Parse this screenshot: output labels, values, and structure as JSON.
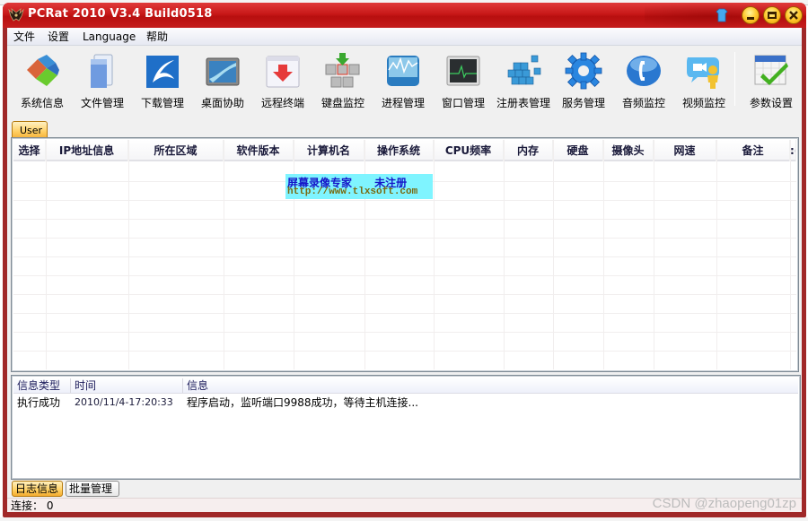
{
  "window": {
    "title": "PCRat 2010 V3.4 Build0518",
    "controls": {
      "skin": "skin-shirt-icon",
      "minimize": "minimize-icon",
      "maximize": "maximize-icon",
      "close": "close-icon"
    }
  },
  "menubar": {
    "items": [
      {
        "label": "文件"
      },
      {
        "label": "设置"
      },
      {
        "label": "Language"
      },
      {
        "label": "帮助"
      }
    ]
  },
  "toolbar": {
    "buttons": [
      {
        "label": "系统信息",
        "icon": "system-info-icon"
      },
      {
        "label": "文件管理",
        "icon": "file-manager-icon"
      },
      {
        "label": "下载管理",
        "icon": "download-manager-icon"
      },
      {
        "label": "桌面协助",
        "icon": "desktop-assist-icon"
      },
      {
        "label": "远程终端",
        "icon": "remote-terminal-icon"
      },
      {
        "label": "键盘监控",
        "icon": "keyboard-monitor-icon"
      },
      {
        "label": "进程管理",
        "icon": "process-manager-icon"
      },
      {
        "label": "窗口管理",
        "icon": "window-manager-icon"
      },
      {
        "label": "注册表管理",
        "icon": "registry-manager-icon"
      },
      {
        "label": "服务管理",
        "icon": "service-manager-icon"
      },
      {
        "label": "音频监控",
        "icon": "audio-monitor-icon"
      },
      {
        "label": "视频监控",
        "icon": "video-monitor-icon"
      },
      {
        "label": "参数设置",
        "icon": "settings-calendar-icon"
      }
    ]
  },
  "group_tab": {
    "label": "User"
  },
  "host_grid": {
    "columns": [
      "选择",
      "IP地址信息",
      "所在区域",
      "软件版本",
      "计算机名",
      "操作系统",
      "CPU频率",
      "内存",
      "硬盘",
      "摄像头",
      "网速",
      "备注",
      ":("
    ],
    "rows": []
  },
  "watermark": {
    "line1": "屏幕录像专家      未注册",
    "line2": "http://www.tlxsoft.com",
    "bg_color": "#7ff4ff"
  },
  "log": {
    "columns": [
      "信息类型",
      "时间",
      "信息"
    ],
    "rows": [
      {
        "type": "执行成功",
        "time": "2010/11/4-17:20:33",
        "message": "程序启动，监听端口9988成功，等待主机连接..."
      }
    ]
  },
  "bottom_tabs": [
    {
      "label": "日志信息",
      "active": true
    },
    {
      "label": "批量管理",
      "active": false
    }
  ],
  "status": {
    "connections_label": "连接： 0"
  },
  "credit": "CSDN @zhaopeng01zp",
  "colors": {
    "title_red": "#c81818",
    "tab_orange": "#ffcf63",
    "frame_border": "#a02828"
  }
}
